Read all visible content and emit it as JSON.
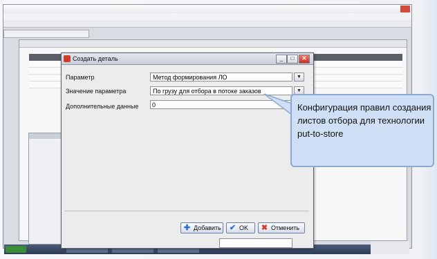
{
  "dialog": {
    "title": "Создать деталь",
    "rows": [
      {
        "label": "Параметр",
        "value": "Метод формирования ЛО"
      },
      {
        "label": "Значение параметра",
        "value": "По грузу для отбора в потоке заказов"
      },
      {
        "label": "Дополнительные данные",
        "value": "0"
      }
    ],
    "buttons": {
      "add": "Добавить",
      "ok": "OK",
      "cancel": "Отменить"
    }
  },
  "callout": {
    "text": "Конфигурация правил создания листов отбора для технологии put-to-store"
  },
  "colors": {
    "accent": "#d23b2a",
    "callout_bg": "#cfe0f6",
    "callout_border": "#8ea9cf"
  }
}
